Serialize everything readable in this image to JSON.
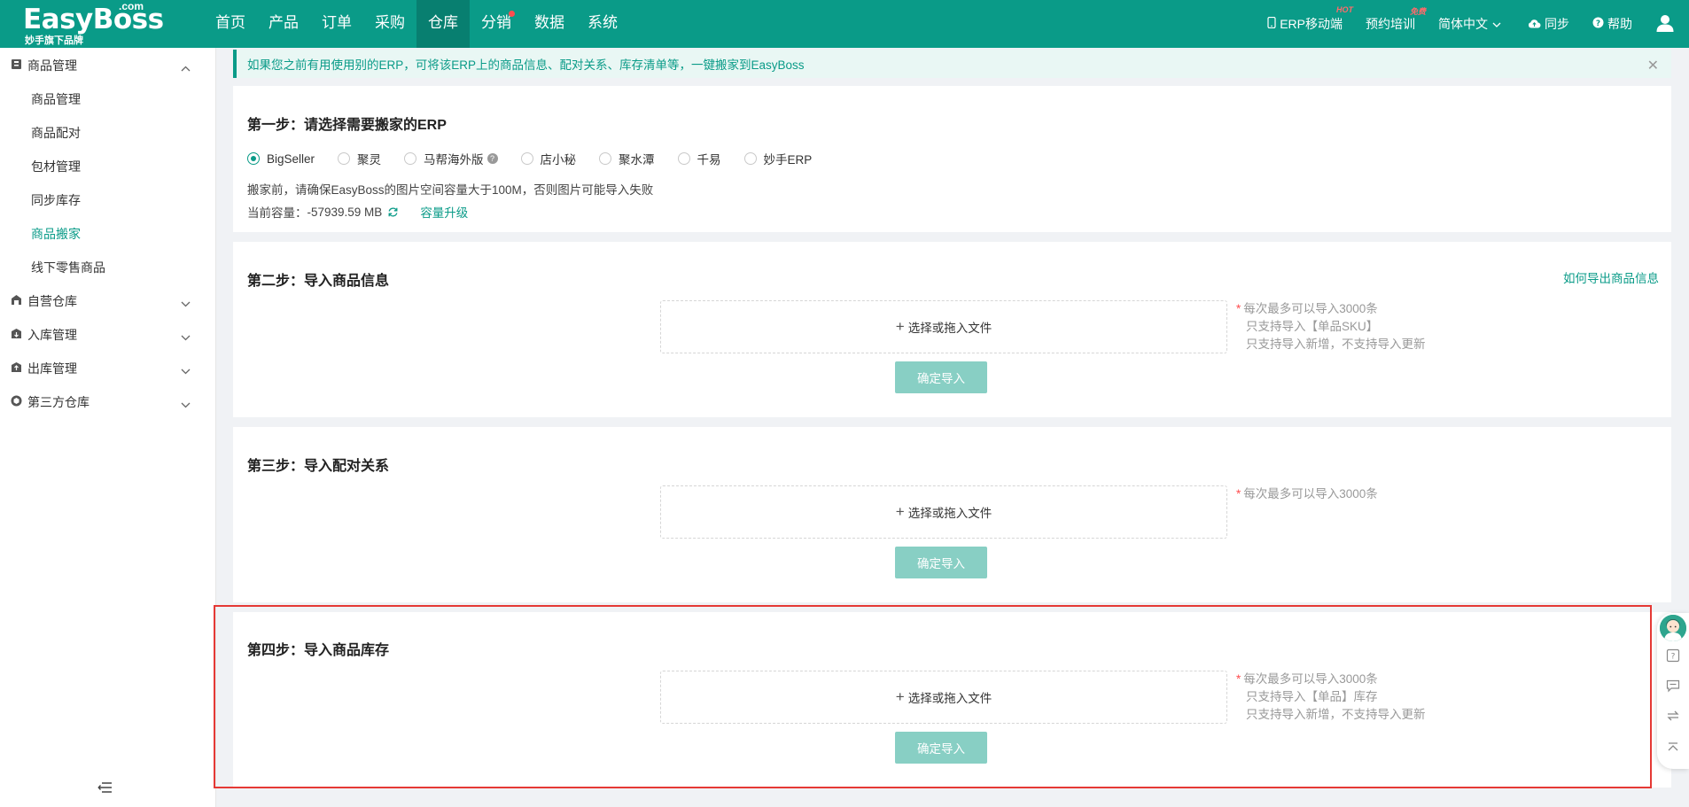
{
  "header": {
    "logo_main": "EasyBoss",
    "logo_com": ".com",
    "logo_sub": "妙手旗下品牌",
    "nav": [
      {
        "label": "首页",
        "active": false
      },
      {
        "label": "产品",
        "active": false
      },
      {
        "label": "订单",
        "active": false
      },
      {
        "label": "采购",
        "active": false
      },
      {
        "label": "仓库",
        "active": true
      },
      {
        "label": "分销",
        "active": false
      },
      {
        "label": "数据",
        "active": false
      },
      {
        "label": "系统",
        "active": false
      }
    ],
    "tools": {
      "mobile": "ERP移动端",
      "mobile_badge": "HOT",
      "training": "预约培训",
      "training_badge": "免费",
      "language": "简体中文",
      "sync": "同步",
      "help": "帮助"
    }
  },
  "sidebar": {
    "groups": [
      {
        "label": "商品管理",
        "expanded": true
      },
      {
        "label": "自营仓库",
        "expanded": false
      },
      {
        "label": "入库管理",
        "expanded": false
      },
      {
        "label": "出库管理",
        "expanded": false
      },
      {
        "label": "第三方仓库",
        "expanded": false
      }
    ],
    "items": [
      "商品管理",
      "商品配对",
      "包材管理",
      "同步库存",
      "商品搬家",
      "线下零售商品"
    ],
    "active_item": "商品搬家"
  },
  "notice": {
    "text": "如果您之前有用使用别的ERP，可将该ERP上的商品信息、配对关系、库存清单等，一键搬家到EasyBoss"
  },
  "step1": {
    "title": "第一步：请选择需要搬家的ERP",
    "options": [
      "BigSeller",
      "聚灵",
      "马帮海外版",
      "店小秘",
      "聚水潭",
      "千易",
      "妙手ERP"
    ],
    "selected": "BigSeller",
    "tip": "搬家前，请确保EasyBoss的图片空间容量大于100M，否则图片可能导入失败",
    "capacity_label": "当前容量：",
    "capacity_value": "-57939.59 MB",
    "upgrade_link": "容量升级"
  },
  "step2": {
    "title": "第二步：导入商品信息",
    "howto_link": "如何导出商品信息",
    "upload_label": "选择或拖入文件",
    "confirm_label": "确定导入",
    "notes": [
      "每次最多可以导入3000条",
      "只支持导入【单品SKU】",
      "只支持导入新增，不支持导入更新"
    ]
  },
  "step3": {
    "title": "第三步：导入配对关系",
    "upload_label": "选择或拖入文件",
    "confirm_label": "确定导入",
    "notes": [
      "每次最多可以导入3000条"
    ]
  },
  "step4": {
    "title": "第四步：导入商品库存",
    "upload_label": "选择或拖入文件",
    "confirm_label": "确定导入",
    "notes": [
      "每次最多可以导入3000条",
      "只支持导入【单品】库存",
      "只支持导入新增，不支持导入更新"
    ]
  },
  "colors": {
    "brand": "#0a9b88",
    "brand_dark": "#087f70",
    "button_disabled": "#88cfc4",
    "highlight": "#e53935"
  }
}
